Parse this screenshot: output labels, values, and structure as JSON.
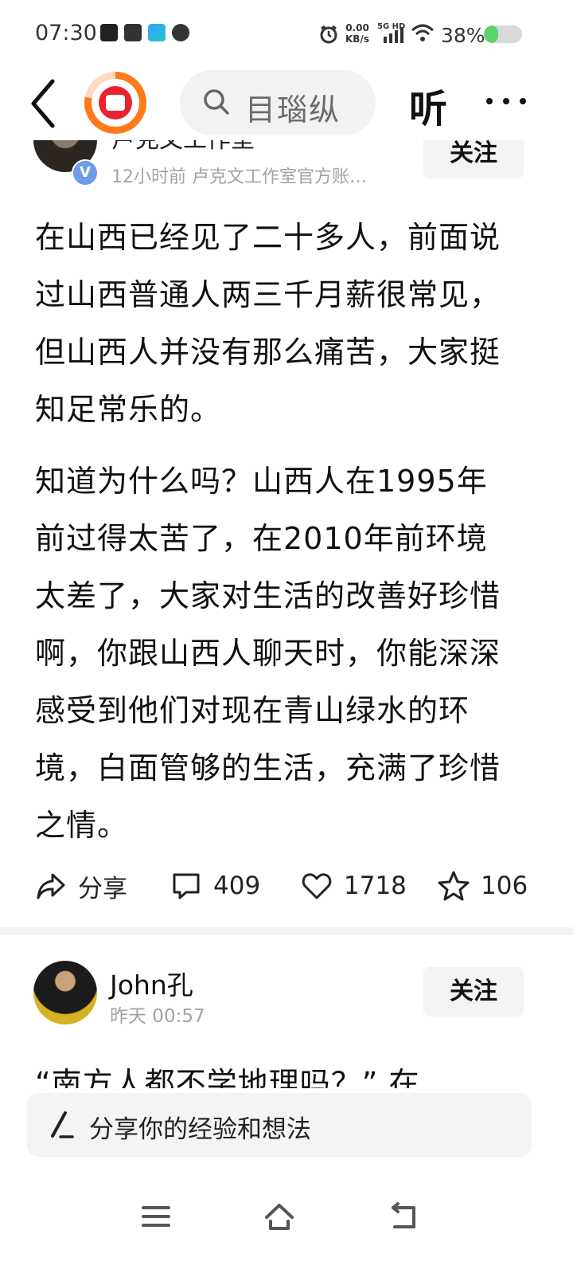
{
  "status_bar": {
    "time": "07:30",
    "net_speed_value": "0.00",
    "net_speed_unit": "KB/s",
    "network_type": "5G HD",
    "battery_percent": "38%",
    "battery_level": 0.38,
    "notification_icons": [
      "tiktok-icon",
      "card-icon",
      "paper-plane-icon",
      "cloud-icon"
    ]
  },
  "header": {
    "search_placeholder": "目瑙纵",
    "listen_label": "听",
    "more_label": "···"
  },
  "post1": {
    "author_name": "卢克文工作室",
    "verified_label": "V",
    "meta": "12小时前  卢克文工作室官方账…",
    "follow_label": "关注",
    "paragraphs": [
      "在山西已经见了二十多人，前面说过山西普通人两三千月薪很常见，但山西人并没有那么痛苦，大家挺知足常乐的。",
      "知道为什么吗？山西人在1995年前过得太苦了，在2010年前环境太差了，大家对生活的改善好珍惜啊，你跟山西人聊天时，你能深深感受到他们对现在青山绿水的环境，白面管够的生活，充满了珍惜之情。"
    ],
    "actions": {
      "share_label": "分享",
      "comments": "409",
      "likes": "1718",
      "favorites": "106"
    }
  },
  "post2": {
    "author_name": "John孔",
    "meta": "昨天  00:57",
    "follow_label": "关注",
    "preview_text": "“南方人都不学地理吗？”  在"
  },
  "comment_box": {
    "placeholder": "分享你的经验和想法"
  },
  "nav": {
    "items": [
      "menu-icon",
      "home-icon",
      "back-icon"
    ]
  }
}
